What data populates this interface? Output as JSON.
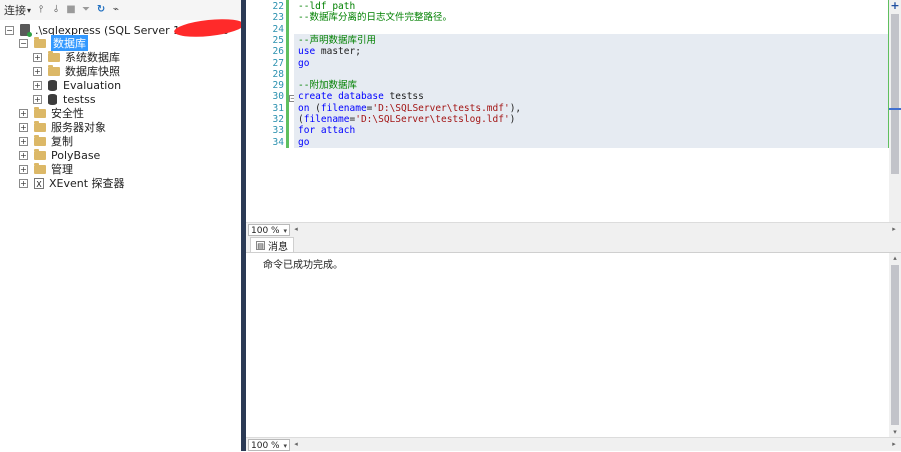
{
  "object_explorer": {
    "toolbar": {
      "connect_label": "连接",
      "connect_dropdown": "▾",
      "icons": [
        "connect-object-icon",
        "disconnect-icon",
        "stop-icon",
        "filter-icon",
        "refresh-icon",
        "activity-monitor-icon"
      ]
    },
    "server": {
      "label": ".\\sqlexpress (SQL Server 14.0.1000",
      "expander": "−"
    },
    "tree": [
      {
        "label": "数据库",
        "expander": "−",
        "icon": "folder-icon",
        "selected": true
      },
      {
        "label": "系统数据库",
        "expander": "+",
        "icon": "folder-icon"
      },
      {
        "label": "数据库快照",
        "expander": "+",
        "icon": "folder-icon"
      },
      {
        "label": "Evaluation",
        "expander": "+",
        "icon": "database-icon"
      },
      {
        "label": "testss",
        "expander": "+",
        "icon": "database-icon"
      },
      {
        "label": "安全性",
        "expander": "+",
        "icon": "folder-icon"
      },
      {
        "label": "服务器对象",
        "expander": "+",
        "icon": "folder-icon"
      },
      {
        "label": "复制",
        "expander": "+",
        "icon": "folder-icon"
      },
      {
        "label": "PolyBase",
        "expander": "+",
        "icon": "folder-icon"
      },
      {
        "label": "管理",
        "expander": "+",
        "icon": "folder-icon"
      },
      {
        "label": "XEvent 探查器",
        "expander": "+",
        "icon": "xevent-icon"
      }
    ]
  },
  "editor": {
    "lines": [
      {
        "num": "22",
        "parts": [
          {
            "t": "--ldf_path",
            "c": "comment"
          }
        ]
      },
      {
        "num": "23",
        "parts": [
          {
            "t": "--数据库分离的日志文件完整路径。",
            "c": "comment"
          }
        ]
      },
      {
        "num": "24",
        "parts": []
      },
      {
        "num": "25",
        "parts": [
          {
            "t": "--声明数据库引用",
            "c": "comment"
          }
        ]
      },
      {
        "num": "26",
        "parts": [
          {
            "t": "use",
            "c": "kw"
          },
          {
            "t": " master",
            "c": "plain"
          },
          {
            "t": ";",
            "c": "plain"
          }
        ]
      },
      {
        "num": "27",
        "parts": [
          {
            "t": "go",
            "c": "kw"
          }
        ]
      },
      {
        "num": "28",
        "parts": []
      },
      {
        "num": "29",
        "parts": [
          {
            "t": "--附加数据库",
            "c": "comment"
          }
        ]
      },
      {
        "num": "30",
        "parts": [
          {
            "t": "create",
            "c": "kw"
          },
          {
            "t": " ",
            "c": "plain"
          },
          {
            "t": "database",
            "c": "kw"
          },
          {
            "t": " testss",
            "c": "plain"
          }
        ]
      },
      {
        "num": "31",
        "parts": [
          {
            "t": "on",
            "c": "kw"
          },
          {
            "t": " (",
            "c": "plain"
          },
          {
            "t": "filename",
            "c": "kw"
          },
          {
            "t": "=",
            "c": "plain"
          },
          {
            "t": "'D:\\SQLServer\\tests.mdf'",
            "c": "str"
          },
          {
            "t": "),",
            "c": "plain"
          }
        ]
      },
      {
        "num": "32",
        "parts": [
          {
            "t": "(",
            "c": "plain"
          },
          {
            "t": "filename",
            "c": "kw"
          },
          {
            "t": "=",
            "c": "plain"
          },
          {
            "t": "'D:\\SQLServer\\testslog.ldf'",
            "c": "str"
          },
          {
            "t": ")",
            "c": "plain"
          }
        ]
      },
      {
        "num": "33",
        "parts": [
          {
            "t": "for attach",
            "c": "kw"
          }
        ]
      },
      {
        "num": "34",
        "parts": [
          {
            "t": "go",
            "c": "kw"
          }
        ]
      }
    ],
    "outline_toggle": "−",
    "zoom": "100 %",
    "zoom_dropdown": "▾",
    "add_icon_label": "+"
  },
  "results": {
    "tab_label": "消息",
    "message": "命令已成功完成。",
    "zoom": "100 %",
    "zoom_dropdown": "▾"
  }
}
